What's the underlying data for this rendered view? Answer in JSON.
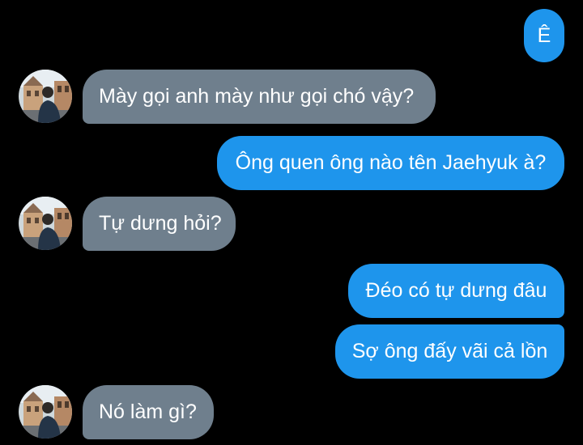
{
  "conversation": {
    "messages": [
      {
        "id": "m1",
        "direction": "sent",
        "text": "Ê"
      },
      {
        "id": "m2",
        "direction": "received",
        "text": "Mày gọi anh mày như gọi chó vậy?"
      },
      {
        "id": "m3",
        "direction": "sent",
        "text": "Ông quen ông nào tên Jaehyuk à?"
      },
      {
        "id": "m4",
        "direction": "received",
        "text": "Tự dưng hỏi?"
      },
      {
        "id": "m5",
        "direction": "sent",
        "text": "Đéo có tự dưng đâu"
      },
      {
        "id": "m6",
        "direction": "sent",
        "text": "Sợ ông đấy vãi cả lồn"
      },
      {
        "id": "m7",
        "direction": "received",
        "text": "Nó làm gì?"
      }
    ]
  },
  "colors": {
    "background": "#000000",
    "sent_bubble": "#1e95ec",
    "received_bubble": "#6f7f8d",
    "text": "#ffffff"
  },
  "icons": {
    "contact_avatar": "contact-avatar-photo"
  }
}
